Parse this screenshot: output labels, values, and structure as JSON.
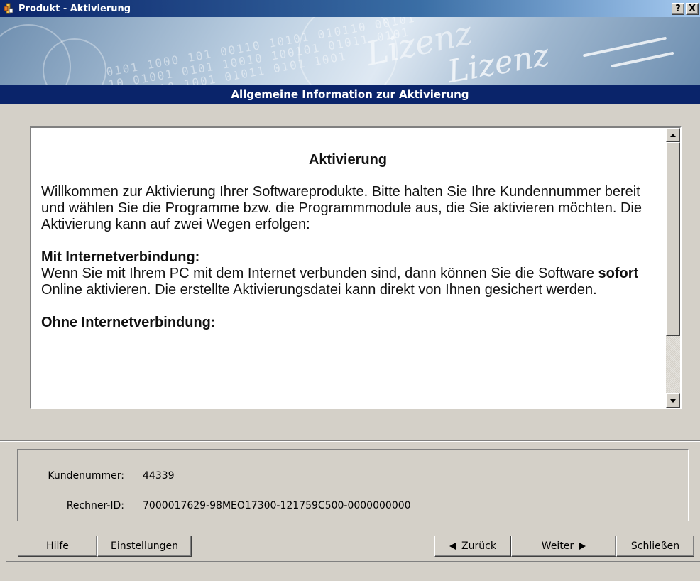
{
  "window": {
    "title": "Produkt - Aktivierung",
    "help_btn": "?",
    "close_btn": "X"
  },
  "banner": {
    "logo_text_1": "Lizenz",
    "logo_text_2": "Lizenz"
  },
  "section": {
    "header": "Allgemeine Information zur Aktivierung"
  },
  "content": {
    "heading": "Aktivierung",
    "intro": "Willkommen zur Aktivierung Ihrer Softwareprodukte. Bitte halten Sie Ihre Kundennummer bereit und wählen Sie die Programme bzw. die Programmmodule aus, die Sie aktivieren möchten. Die Aktivierung kann auf zwei Wegen erfolgen:",
    "online_heading": "Mit Internetverbindung:",
    "online_text_before": "Wenn Sie mit Ihrem PC mit dem Internet verbunden sind, dann können Sie die Software ",
    "online_text_bold": "sofort",
    "online_text_after": " Online aktivieren. Die erstellte Aktivierungsdatei kann direkt von Ihnen gesichert werden.",
    "offline_heading": "Ohne Internetverbindung:"
  },
  "info": {
    "customer_label": "Kundenummer:",
    "customer_value": "44339",
    "machine_label": "Rechner-ID:",
    "machine_value": "7000017629-98MEO17300-121759C500-0000000000"
  },
  "buttons": {
    "help": "Hilfe",
    "settings": "Einstellungen",
    "back": "Zurück",
    "next": "Weiter",
    "close": "Schließen"
  }
}
